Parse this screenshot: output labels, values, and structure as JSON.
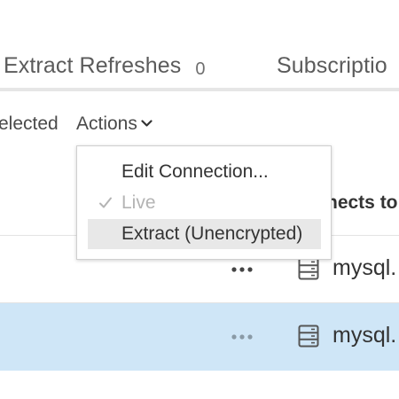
{
  "tabs": {
    "extract_refreshes": {
      "label": "Extract Refreshes",
      "count": "0"
    },
    "subscriptions": {
      "label": "Subscriptio"
    }
  },
  "toolbar": {
    "selected_text": "elected",
    "actions_label": "Actions"
  },
  "table": {
    "connects_to_header": "nects to",
    "rows": [
      {
        "connection": "mysql.",
        "selected": false
      },
      {
        "connection": "mysql.",
        "selected": true
      }
    ]
  },
  "actions_menu": {
    "items": [
      {
        "label": "Edit Connection...",
        "enabled": true,
        "checked": false
      },
      {
        "label": "Live",
        "enabled": false,
        "checked": true
      },
      {
        "label": "Extract (Unencrypted)",
        "enabled": true,
        "checked": false,
        "highlighted": true
      }
    ]
  },
  "icons": {
    "more": "more-options-icon",
    "database": "database-icon",
    "chevron": "chevron-down-icon",
    "check": "check-icon"
  },
  "colors": {
    "selected_row_bg": "#cfe6f7",
    "menu_highlight_bg": "#e8e8e8",
    "disabled_text": "#b4b4b4"
  }
}
